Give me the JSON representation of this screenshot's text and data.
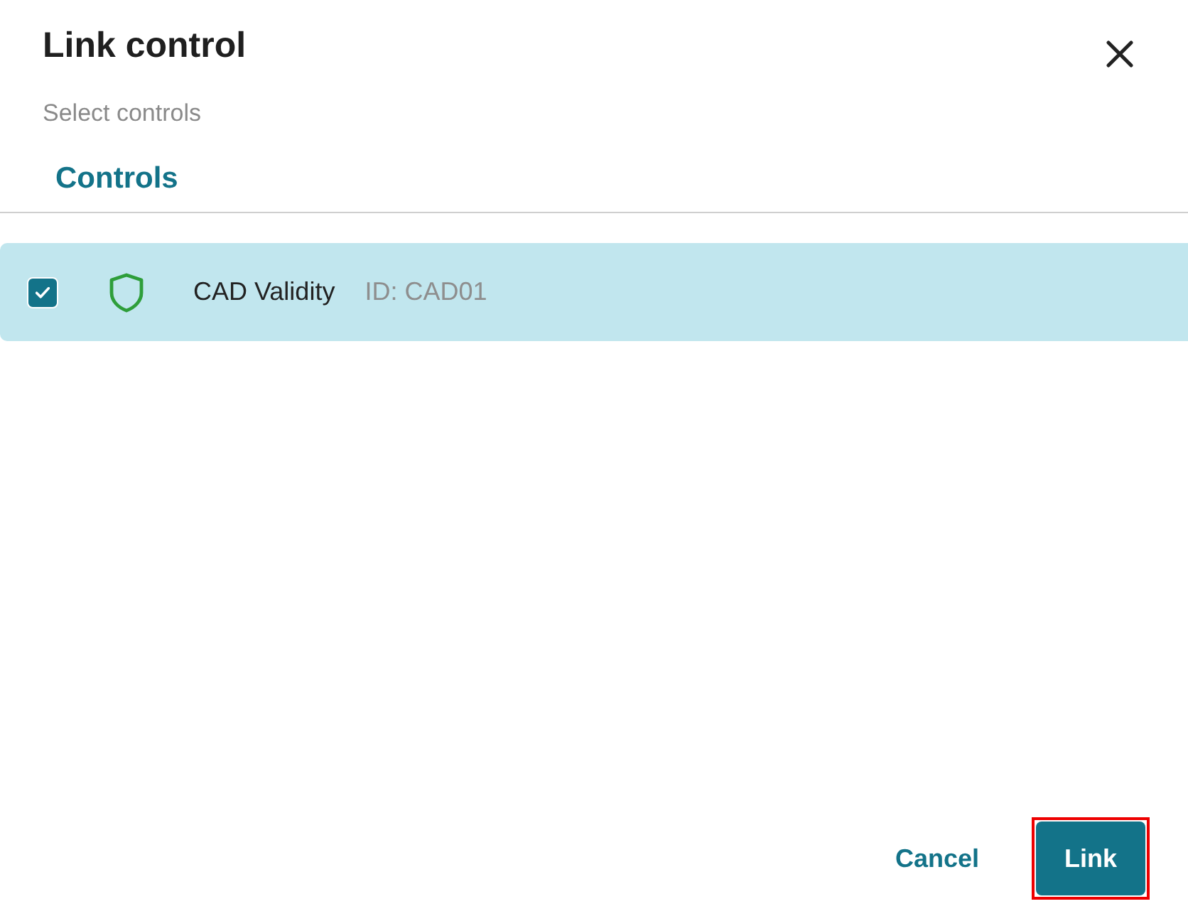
{
  "dialog": {
    "title": "Link control",
    "subtitle": "Select controls"
  },
  "tabs": [
    {
      "label": "Controls",
      "selected": true
    }
  ],
  "controls": [
    {
      "name": "CAD Validity",
      "id": "ID: CAD01",
      "checked": true
    }
  ],
  "buttons": [
    {
      "label": "Cancel",
      "kind": "text"
    },
    {
      "label": "Link",
      "kind": "primary",
      "highlighted": true
    }
  ]
}
